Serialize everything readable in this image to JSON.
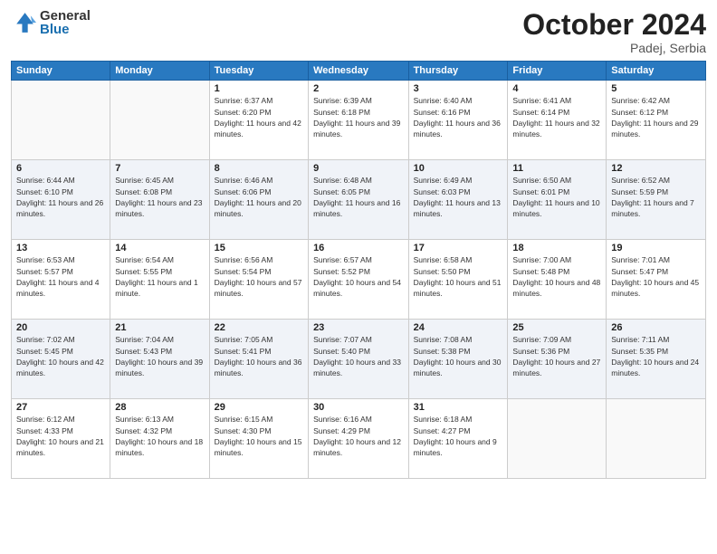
{
  "header": {
    "logo_general": "General",
    "logo_blue": "Blue",
    "month_title": "October 2024",
    "subtitle": "Padej, Serbia"
  },
  "weekdays": [
    "Sunday",
    "Monday",
    "Tuesday",
    "Wednesday",
    "Thursday",
    "Friday",
    "Saturday"
  ],
  "weeks": [
    [
      {
        "day": "",
        "info": ""
      },
      {
        "day": "",
        "info": ""
      },
      {
        "day": "1",
        "info": "Sunrise: 6:37 AM\nSunset: 6:20 PM\nDaylight: 11 hours and 42 minutes."
      },
      {
        "day": "2",
        "info": "Sunrise: 6:39 AM\nSunset: 6:18 PM\nDaylight: 11 hours and 39 minutes."
      },
      {
        "day": "3",
        "info": "Sunrise: 6:40 AM\nSunset: 6:16 PM\nDaylight: 11 hours and 36 minutes."
      },
      {
        "day": "4",
        "info": "Sunrise: 6:41 AM\nSunset: 6:14 PM\nDaylight: 11 hours and 32 minutes."
      },
      {
        "day": "5",
        "info": "Sunrise: 6:42 AM\nSunset: 6:12 PM\nDaylight: 11 hours and 29 minutes."
      }
    ],
    [
      {
        "day": "6",
        "info": "Sunrise: 6:44 AM\nSunset: 6:10 PM\nDaylight: 11 hours and 26 minutes."
      },
      {
        "day": "7",
        "info": "Sunrise: 6:45 AM\nSunset: 6:08 PM\nDaylight: 11 hours and 23 minutes."
      },
      {
        "day": "8",
        "info": "Sunrise: 6:46 AM\nSunset: 6:06 PM\nDaylight: 11 hours and 20 minutes."
      },
      {
        "day": "9",
        "info": "Sunrise: 6:48 AM\nSunset: 6:05 PM\nDaylight: 11 hours and 16 minutes."
      },
      {
        "day": "10",
        "info": "Sunrise: 6:49 AM\nSunset: 6:03 PM\nDaylight: 11 hours and 13 minutes."
      },
      {
        "day": "11",
        "info": "Sunrise: 6:50 AM\nSunset: 6:01 PM\nDaylight: 11 hours and 10 minutes."
      },
      {
        "day": "12",
        "info": "Sunrise: 6:52 AM\nSunset: 5:59 PM\nDaylight: 11 hours and 7 minutes."
      }
    ],
    [
      {
        "day": "13",
        "info": "Sunrise: 6:53 AM\nSunset: 5:57 PM\nDaylight: 11 hours and 4 minutes."
      },
      {
        "day": "14",
        "info": "Sunrise: 6:54 AM\nSunset: 5:55 PM\nDaylight: 11 hours and 1 minute."
      },
      {
        "day": "15",
        "info": "Sunrise: 6:56 AM\nSunset: 5:54 PM\nDaylight: 10 hours and 57 minutes."
      },
      {
        "day": "16",
        "info": "Sunrise: 6:57 AM\nSunset: 5:52 PM\nDaylight: 10 hours and 54 minutes."
      },
      {
        "day": "17",
        "info": "Sunrise: 6:58 AM\nSunset: 5:50 PM\nDaylight: 10 hours and 51 minutes."
      },
      {
        "day": "18",
        "info": "Sunrise: 7:00 AM\nSunset: 5:48 PM\nDaylight: 10 hours and 48 minutes."
      },
      {
        "day": "19",
        "info": "Sunrise: 7:01 AM\nSunset: 5:47 PM\nDaylight: 10 hours and 45 minutes."
      }
    ],
    [
      {
        "day": "20",
        "info": "Sunrise: 7:02 AM\nSunset: 5:45 PM\nDaylight: 10 hours and 42 minutes."
      },
      {
        "day": "21",
        "info": "Sunrise: 7:04 AM\nSunset: 5:43 PM\nDaylight: 10 hours and 39 minutes."
      },
      {
        "day": "22",
        "info": "Sunrise: 7:05 AM\nSunset: 5:41 PM\nDaylight: 10 hours and 36 minutes."
      },
      {
        "day": "23",
        "info": "Sunrise: 7:07 AM\nSunset: 5:40 PM\nDaylight: 10 hours and 33 minutes."
      },
      {
        "day": "24",
        "info": "Sunrise: 7:08 AM\nSunset: 5:38 PM\nDaylight: 10 hours and 30 minutes."
      },
      {
        "day": "25",
        "info": "Sunrise: 7:09 AM\nSunset: 5:36 PM\nDaylight: 10 hours and 27 minutes."
      },
      {
        "day": "26",
        "info": "Sunrise: 7:11 AM\nSunset: 5:35 PM\nDaylight: 10 hours and 24 minutes."
      }
    ],
    [
      {
        "day": "27",
        "info": "Sunrise: 6:12 AM\nSunset: 4:33 PM\nDaylight: 10 hours and 21 minutes."
      },
      {
        "day": "28",
        "info": "Sunrise: 6:13 AM\nSunset: 4:32 PM\nDaylight: 10 hours and 18 minutes."
      },
      {
        "day": "29",
        "info": "Sunrise: 6:15 AM\nSunset: 4:30 PM\nDaylight: 10 hours and 15 minutes."
      },
      {
        "day": "30",
        "info": "Sunrise: 6:16 AM\nSunset: 4:29 PM\nDaylight: 10 hours and 12 minutes."
      },
      {
        "day": "31",
        "info": "Sunrise: 6:18 AM\nSunset: 4:27 PM\nDaylight: 10 hours and 9 minutes."
      },
      {
        "day": "",
        "info": ""
      },
      {
        "day": "",
        "info": ""
      }
    ]
  ]
}
